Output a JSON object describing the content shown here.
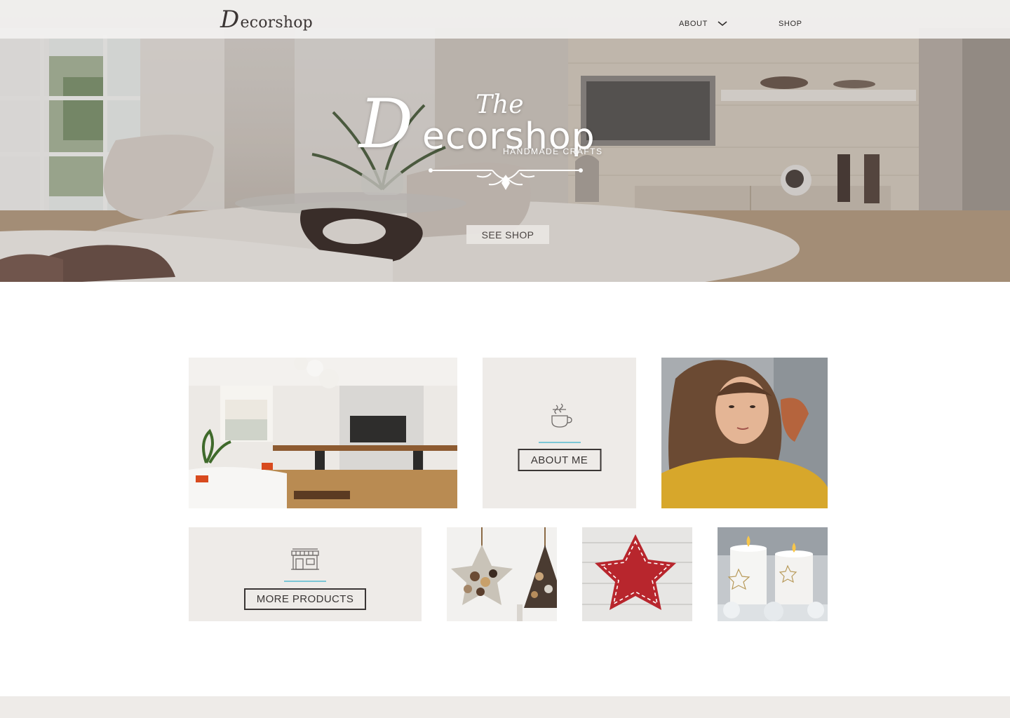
{
  "header": {
    "brand_initial": "D",
    "brand_rest": "ecorshop",
    "nav": {
      "about_label": "ABOUT",
      "shop_label": "SHOP"
    }
  },
  "hero": {
    "logo_the": "The",
    "logo_initial": "D",
    "logo_rest": "ecorshop",
    "tagline": "HANDMADE CRAFTS",
    "cta_label": "SEE SHOP"
  },
  "tiles": {
    "about_label": "ABOUT ME",
    "products_label": "MORE PRODUCTS"
  },
  "colors": {
    "panel_bg": "#eeebe8",
    "accent_line": "#7bc6d6",
    "text_dark": "#3a3635"
  },
  "icons": [
    "chevron-down-icon",
    "coffee-cup-icon",
    "shop-icon",
    "ornament-divider-icon"
  ]
}
